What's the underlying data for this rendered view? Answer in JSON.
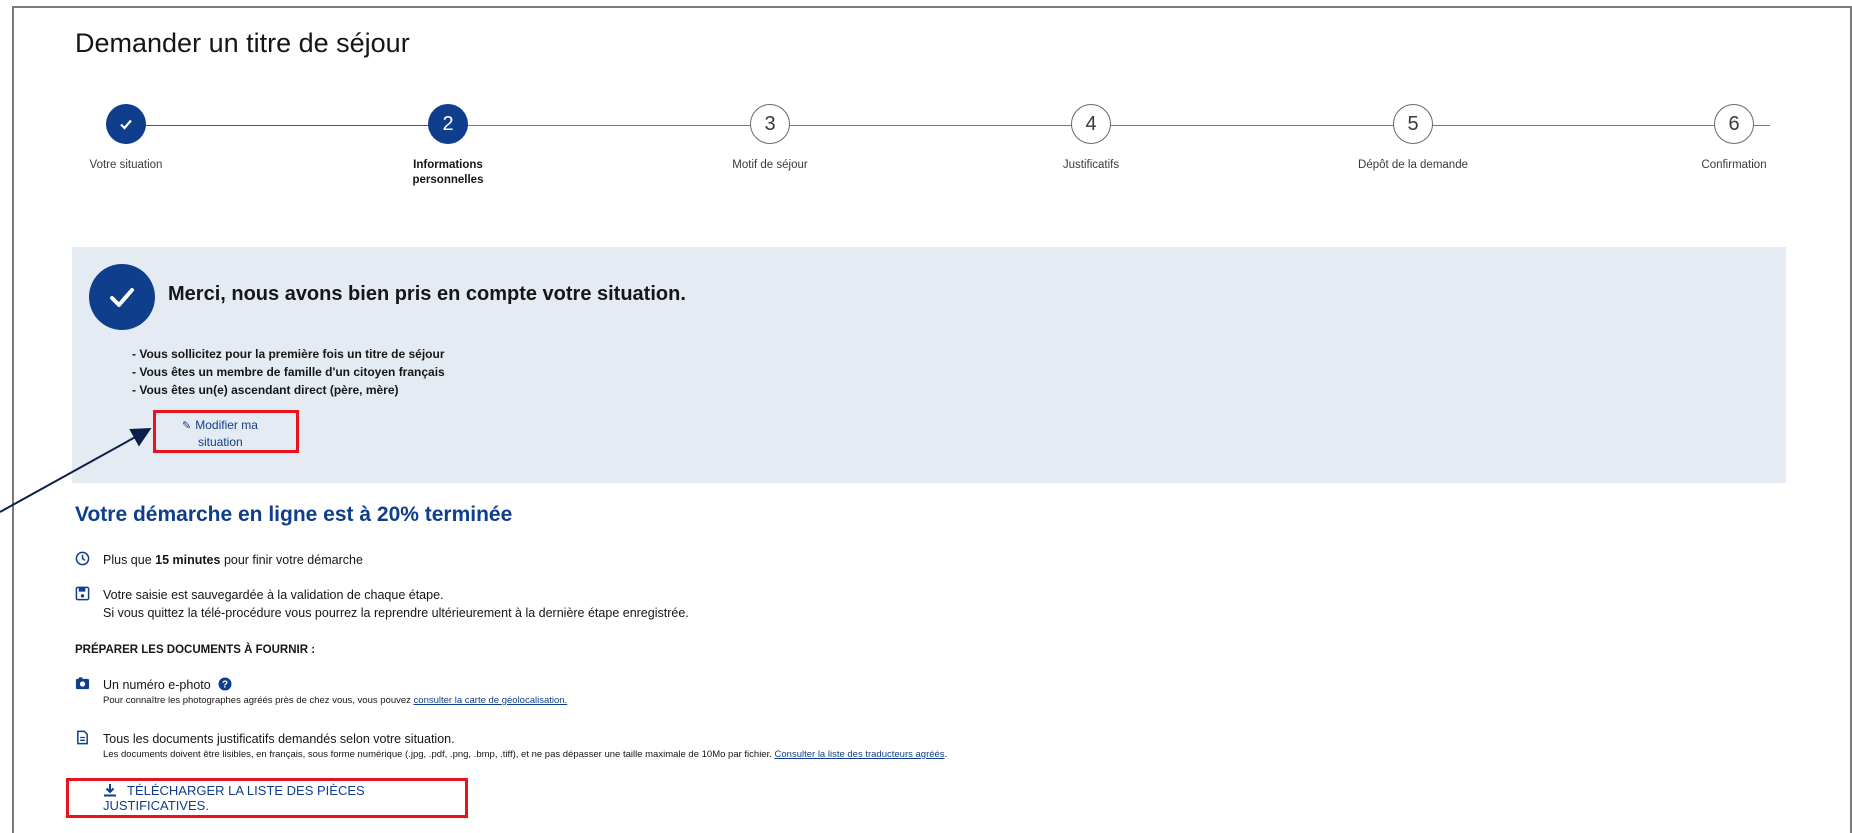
{
  "page": {
    "title": "Demander un titre de séjour"
  },
  "stepper": {
    "steps": [
      {
        "number": "✓",
        "label": "Votre situation",
        "state": "done"
      },
      {
        "number": "2",
        "label": "Informations personnelles",
        "state": "current"
      },
      {
        "number": "3",
        "label": "Motif de séjour",
        "state": "todo"
      },
      {
        "number": "4",
        "label": "Justificatifs",
        "state": "todo"
      },
      {
        "number": "5",
        "label": "Dépôt de la demande",
        "state": "todo"
      },
      {
        "number": "6",
        "label": "Confirmation",
        "state": "todo"
      }
    ]
  },
  "info": {
    "title": "Merci, nous avons bien pris en compte votre situation.",
    "items": [
      "- Vous sollicitez pour la première fois un titre de séjour",
      "- Vous êtes un membre de famille d'un citoyen français",
      "- Vous êtes un(e) ascendant direct (père, mère)"
    ],
    "modify_label_1": "Modifier ma",
    "modify_label_2": "situation"
  },
  "progress": {
    "title": "Votre démarche en ligne est à 20% terminée",
    "percent": 20,
    "time_prefix": "Plus que",
    "time_value": "15 minutes",
    "time_suffix": "pour finir votre démarche",
    "save_line1": "Votre saisie est sauvegardée à la validation de chaque étape.",
    "save_line2": "Si vous quittez la télé-procédure vous pourrez la reprendre ultérieurement à la dernière étape enregistrée."
  },
  "documents": {
    "heading": "PRÉPARER LES DOCUMENTS À FOURNIR :",
    "photo_label": "Un numéro e-photo",
    "photo_note_prefix": "Pour connaître les photographes agréés près de chez vous, vous pouvez",
    "photo_note_link": "consulter la carte de géolocalisation.",
    "docs_label": "Tous les documents justificatifs demandés selon votre situation.",
    "docs_note": "Les documents doivent être lisibles, en français, sous forme numérique (.jpg, .pdf, .png, .bmp, .tiff), et ne pas dépasser une taille maximale de 10Mo par fichier.",
    "docs_note_link": "Consulter la liste des traducteurs agréés",
    "download_label": "TÉLÉCHARGER LA LISTE DES PIÈCES JUSTIFICATIVES."
  },
  "colors": {
    "primary": "#0f3e8c",
    "highlight": "#e8141c",
    "info_bg": "#e5ebf3"
  },
  "icons": [
    "check-icon",
    "pencil-icon",
    "clock-icon",
    "save-icon",
    "camera-icon",
    "help-icon",
    "document-icon",
    "download-icon"
  ]
}
